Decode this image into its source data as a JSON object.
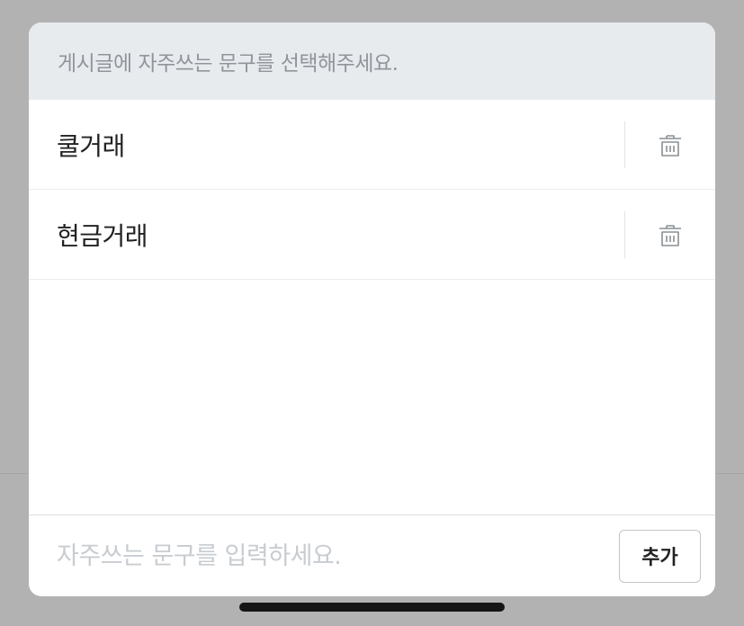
{
  "modal": {
    "header_text": "게시글에 자주쓰는 문구를 선택해주세요.",
    "phrases": [
      {
        "label": "쿨거래",
        "delete_icon": "trash-icon"
      },
      {
        "label": "현금거래",
        "delete_icon": "trash-icon"
      }
    ],
    "input": {
      "value": "",
      "placeholder": "자주쓰는 문구를 입력하세요."
    },
    "add_button_label": "추가"
  },
  "colors": {
    "backdrop": "#b2b2b2",
    "header_bg": "#e8ebee",
    "header_text": "#8f959b",
    "item_text": "#222222",
    "placeholder": "#c8ccd0",
    "icon": "#8a8f94"
  }
}
